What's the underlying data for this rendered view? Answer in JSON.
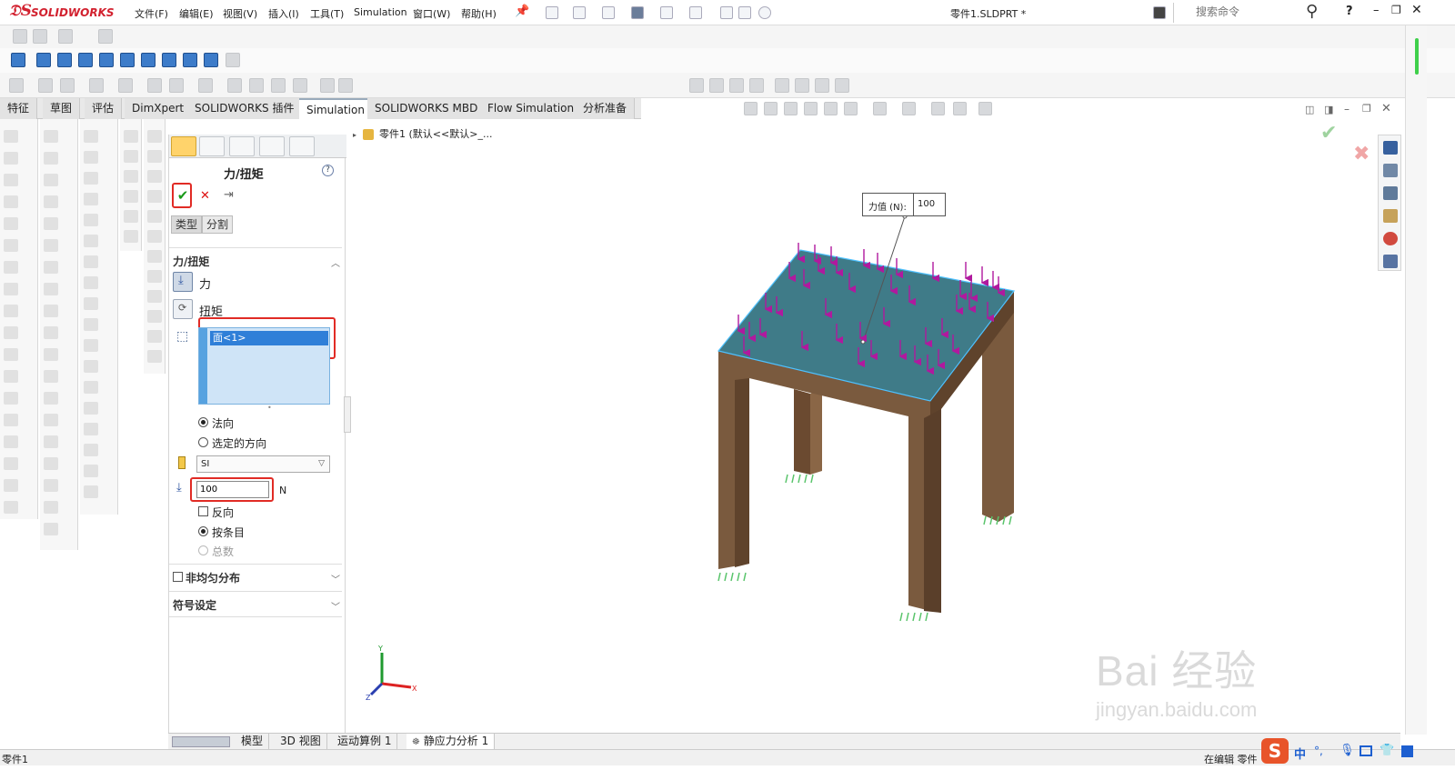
{
  "app": {
    "logo_text": "SOLIDWORKS",
    "document_title": "零件1.SLDPRT *"
  },
  "menu": [
    {
      "label": "文件(F)"
    },
    {
      "label": "编辑(E)"
    },
    {
      "label": "视图(V)"
    },
    {
      "label": "插入(I)"
    },
    {
      "label": "工具(T)"
    },
    {
      "label": "Simulation"
    },
    {
      "label": "窗口(W)"
    },
    {
      "label": "帮助(H)"
    }
  ],
  "search": {
    "placeholder": "搜索命令"
  },
  "command_tabs": [
    {
      "label": "特征",
      "active": false
    },
    {
      "label": "草图",
      "active": false
    },
    {
      "label": "评估",
      "active": false
    },
    {
      "label": "DimXpert",
      "active": false
    },
    {
      "label": "SOLIDWORKS 插件",
      "active": false
    },
    {
      "label": "Simulation",
      "active": true
    },
    {
      "label": "SOLIDWORKS MBD",
      "active": false
    },
    {
      "label": "Flow Simulation",
      "active": false
    },
    {
      "label": "分析准备",
      "active": false
    }
  ],
  "feature_tree": {
    "path": "零件1 (默认<<默认>_..."
  },
  "property_manager": {
    "title": "力/扭矩",
    "subtabs": [
      "类型",
      "分割"
    ],
    "section_force": "力/扭矩",
    "option_force": "力",
    "option_torque": "扭矩",
    "selected_face": "面<1>",
    "direction_normal": "法向",
    "direction_selected": "选定的方向",
    "unit_system": "SI",
    "force_value": "100",
    "force_unit": "N",
    "reverse_label": "反向",
    "per_item_label": "按条目",
    "total_label": "总数",
    "nonuniform_label": "非均匀分布",
    "symbol_section": "符号设定"
  },
  "graphics": {
    "force_tag_label": "力值 (N):",
    "force_tag_value": "100",
    "colors": {
      "top_face": "#3f7b88",
      "legs": "#7a5a3e",
      "load_arrows": "#b0199e",
      "fixture": "#59c46b"
    }
  },
  "bottom_tabs": [
    {
      "label": "模型"
    },
    {
      "label": "3D 视图"
    },
    {
      "label": "运动算例 1"
    },
    {
      "label": "静应力分析 1"
    }
  ],
  "status": {
    "left": "零件1",
    "right": "在编辑 零件"
  },
  "ime": {
    "chars": [
      "中",
      "°,"
    ]
  },
  "watermark": {
    "main": "Bai 经验",
    "url": "jingyan.baidu.com"
  }
}
